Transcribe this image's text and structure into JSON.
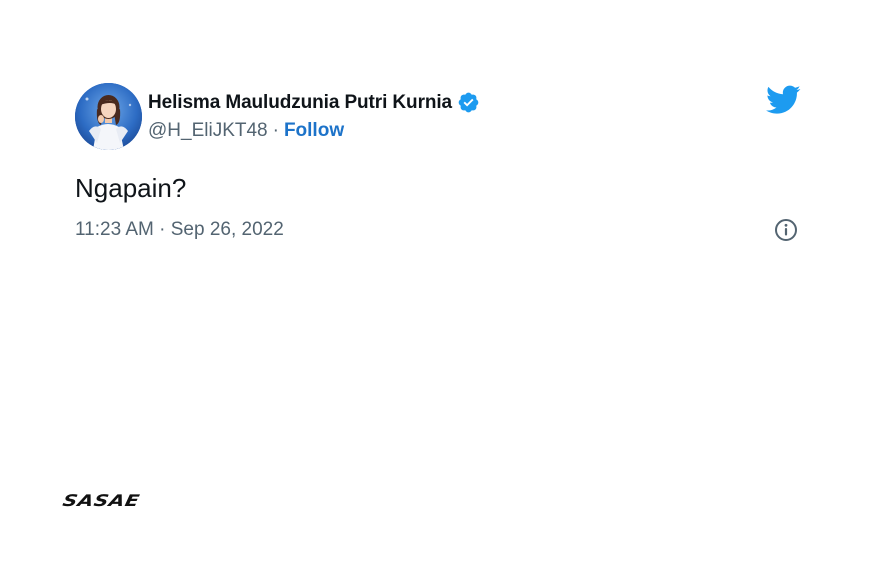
{
  "tweet": {
    "author": {
      "display_name": "Helisma Mauludzunia Putri Kurnia",
      "handle": "@H_EliJKT48",
      "verified_icon": "verified-badge-icon",
      "avatar": "profile-avatar"
    },
    "separator": "·",
    "follow_label": "Follow",
    "text": "Ngapain?",
    "timestamp": "11:23 AM · Sep 26, 2022",
    "platform_icon": "twitter-bird-icon",
    "info_icon": "info-icon"
  },
  "brand": {
    "watermark": "SASAE"
  },
  "colors": {
    "text_primary": "#0f1419",
    "text_secondary": "#536471",
    "follow_link": "#1d73c9",
    "twitter_blue": "#1d9bf0"
  }
}
